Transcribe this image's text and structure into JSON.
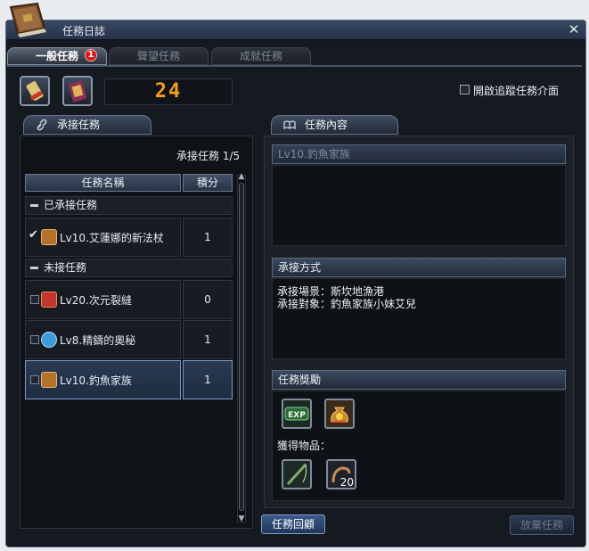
{
  "window": {
    "title": "任務日誌",
    "close_glyph": "✕"
  },
  "tabs": [
    {
      "label": "一般任務",
      "badge": "1",
      "active": true
    },
    {
      "label": "聲望任務"
    },
    {
      "label": "成就任務"
    }
  ],
  "counter": {
    "value": "24"
  },
  "tracking": {
    "label": "開啟追蹤任務介面",
    "checked": false
  },
  "accepted_panel": {
    "header": "承接任務",
    "header_icon": "link-icon",
    "count_text": "承接任務 1/5",
    "columns": {
      "name": "任務名稱",
      "points": "積分"
    },
    "groups": [
      {
        "label": "已承接任務",
        "quests": [
          {
            "name": "Lv10.艾蓮娜的新法杖",
            "points": "1",
            "checked": true,
            "icon": "chest-icon",
            "icon_color": "#b5702a"
          }
        ]
      },
      {
        "label": "未接任務",
        "quests": [
          {
            "name": "Lv20.次元裂縫",
            "points": "0",
            "checked": false,
            "icon": "rift-icon",
            "icon_color": "#c2362d"
          },
          {
            "name": "Lv8.精鑄的奧秘",
            "points": "1",
            "checked": false,
            "icon": "speech-bubble-icon",
            "icon_color": "#3e9bd8"
          },
          {
            "name": "Lv10.釣魚家族",
            "points": "1",
            "checked": false,
            "icon": "chest-icon",
            "icon_color": "#b5702a",
            "selected": true
          }
        ]
      }
    ]
  },
  "detail_panel": {
    "header": "任務內容",
    "header_icon": "book-icon",
    "quest_title": "Lv10.釣魚家族",
    "method_header": "承接方式",
    "method_lines": [
      "承接場景：斯坎地漁港",
      "承接對象：釣魚家族小妹艾兒"
    ],
    "reward_header": "任務獎勵",
    "rewards": [
      {
        "icon": "exp-icon",
        "text": "EXP"
      },
      {
        "icon": "money-bag-icon"
      }
    ],
    "obtained_label": "獲得物品：",
    "items": [
      {
        "icon": "fishing-rod-icon"
      },
      {
        "icon": "bait-hook-icon",
        "count": "20"
      }
    ]
  },
  "buttons": {
    "review": "任務回顧",
    "abandon": "放棄任務"
  }
}
